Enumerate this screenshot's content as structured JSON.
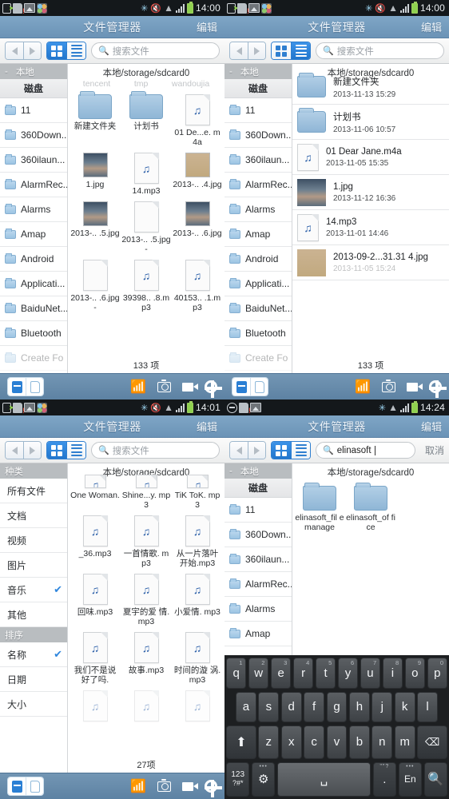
{
  "app": {
    "title": "文件管理器",
    "edit_label": "编辑",
    "search_placeholder": "搜索文件",
    "path": "本地/storage/sdcard0",
    "cancel_label": "取消"
  },
  "icons": {
    "back": "triangle-left-icon",
    "forward": "triangle-right-icon",
    "grid_view": "grid-view-icon",
    "list_view": "list-view-icon",
    "search": "search-icon",
    "wifi": "wifi-icon",
    "camera": "camera-icon",
    "video": "video-icon",
    "settings": "gear-icon"
  },
  "colors": {
    "title_bar": "#6b93b6",
    "app_bar": "#5d82a3",
    "accent_blue": "#2176cd",
    "sidebar_header": "#b9bdc0",
    "check_blue": "#2f86dd",
    "status_bar": "#14181b",
    "battery_green": "#8fd14f"
  },
  "panels": [
    {
      "id": "panel-grid-view",
      "status": {
        "time": "14:00",
        "icons": [
          "usb-icon",
          "sd-card-icon",
          "image-icon",
          "apps-icon",
          "bluetooth-icon",
          "mute-icon",
          "wifi-icon",
          "signal-icon",
          "battery-icon"
        ]
      },
      "view_mode": "grid",
      "search_value": "",
      "sidebar": {
        "header": "本地",
        "header_dash": "-",
        "subheader": "磁盘",
        "items": [
          {
            "label": "11"
          },
          {
            "label": "360Down..."
          },
          {
            "label": "360ilaun..."
          },
          {
            "label": "AlarmRec..."
          },
          {
            "label": "Alarms"
          },
          {
            "label": "Amap"
          },
          {
            "label": "Android"
          },
          {
            "label": "Applicati..."
          },
          {
            "label": "BaiduNet..."
          },
          {
            "label": "Bluetooth"
          },
          {
            "label": "Create Fo"
          }
        ]
      },
      "ghost_row": [
        "tencent",
        "tmp",
        "wandoujia"
      ],
      "items": [
        {
          "name": "新建文件夹",
          "type": "folder"
        },
        {
          "name": "计划书",
          "type": "folder"
        },
        {
          "name": "01 De...e.\nm4a",
          "type": "audio"
        },
        {
          "name": "1.jpg",
          "type": "image-car"
        },
        {
          "name": "14.mp3",
          "type": "audio"
        },
        {
          "name": "2013-..\n.4.jpg",
          "type": "image-tan"
        },
        {
          "name": "2013-..\n.5.jpg",
          "type": "image-car"
        },
        {
          "name": "2013-..\n.5.jpg-",
          "type": "blank"
        },
        {
          "name": "2013-..\n.6.jpg",
          "type": "image-car"
        },
        {
          "name": "2013-..\n.6.jpg-",
          "type": "blank"
        },
        {
          "name": "39398..\n.8.mp3",
          "type": "audio"
        },
        {
          "name": "40153..\n.1.mp3",
          "type": "audio"
        }
      ],
      "count": "133 项"
    },
    {
      "id": "panel-list-view",
      "status": {
        "time": "14:00",
        "icons": [
          "usb-icon",
          "sd-card-icon",
          "image-icon",
          "apps-icon",
          "bluetooth-icon",
          "mute-icon",
          "wifi-icon",
          "signal-icon",
          "battery-icon"
        ]
      },
      "view_mode": "list",
      "search_value": "",
      "sidebar": {
        "header": "本地",
        "header_dash": "-",
        "subheader": "磁盘",
        "items": [
          {
            "label": "11"
          },
          {
            "label": "360Down..."
          },
          {
            "label": "360ilaun..."
          },
          {
            "label": "AlarmRec..."
          },
          {
            "label": "Alarms"
          },
          {
            "label": "Amap"
          },
          {
            "label": "Android"
          },
          {
            "label": "Applicati..."
          },
          {
            "label": "BaiduNet..."
          },
          {
            "label": "Bluetooth"
          },
          {
            "label": "Create Fo"
          }
        ]
      },
      "rows": [
        {
          "name": "新建文件夹",
          "date": "2013-11-13 15:29",
          "type": "folder"
        },
        {
          "name": "计划书",
          "date": "2013-11-06 10:57",
          "type": "folder"
        },
        {
          "name": "01 Dear Jane.m4a",
          "date": "2013-11-05 15:35",
          "type": "audio"
        },
        {
          "name": "1.jpg",
          "date": "2013-11-12 16:36",
          "type": "image-car"
        },
        {
          "name": "14.mp3",
          "date": "2013-11-01 14:46",
          "type": "audio"
        },
        {
          "name": "2013-09-2...31.31 4.jpg",
          "date": "2013-11-05 15:24",
          "type": "image-tan"
        }
      ],
      "count": "133 项"
    },
    {
      "id": "panel-music-filter",
      "status": {
        "time": "14:01",
        "icons": [
          "usb-icon",
          "sd-card-icon",
          "image-icon",
          "apps-icon",
          "bluetooth-icon",
          "mute-icon",
          "wifi-icon",
          "signal-icon",
          "battery-icon"
        ]
      },
      "view_mode": "grid",
      "search_value": "",
      "sidebar": {
        "header": "种类",
        "items": [
          {
            "label": "所有文件",
            "checked": false
          },
          {
            "label": "文档",
            "checked": false
          },
          {
            "label": "视频",
            "checked": false
          },
          {
            "label": "图片",
            "checked": false
          },
          {
            "label": "音乐",
            "checked": true
          },
          {
            "label": "其他",
            "checked": false
          }
        ],
        "header2": "排序",
        "items2": [
          {
            "label": "名称",
            "checked": true
          },
          {
            "label": "日期",
            "checked": false
          },
          {
            "label": "大小",
            "checked": false
          }
        ]
      },
      "items": [
        {
          "name": "One\nWoman.",
          "type": "audio-cut"
        },
        {
          "name": "Shine...y.\nmp3",
          "type": "audio-cut"
        },
        {
          "name": "TiK ToK.\nmp3",
          "type": "audio-cut"
        },
        {
          "name": "_36.mp3",
          "type": "audio"
        },
        {
          "name": "一首情歌.\nmp3",
          "type": "audio"
        },
        {
          "name": "从一片落叶\n开始.mp3",
          "type": "audio"
        },
        {
          "name": "回味.mp3",
          "type": "audio"
        },
        {
          "name": "夏宇的爱\n情.mp3",
          "type": "audio"
        },
        {
          "name": "小爱情.\nmp3",
          "type": "audio"
        },
        {
          "name": "我们不是说\n好了吗.",
          "type": "audio"
        },
        {
          "name": "故事.mp3",
          "type": "audio"
        },
        {
          "name": "时间的漩\n涡.mp3",
          "type": "audio"
        },
        {
          "name": "",
          "type": "audio-faint"
        },
        {
          "name": "",
          "type": "audio-faint"
        },
        {
          "name": "",
          "type": "audio-faint"
        }
      ],
      "count": "27项"
    },
    {
      "id": "panel-search-keyboard",
      "status": {
        "time": "14:24",
        "icons": [
          "minus-circle-icon",
          "sd-card-icon",
          "image-icon",
          "bluetooth-icon",
          "wifi-sync-icon",
          "signal-icon",
          "battery-icon"
        ]
      },
      "view_mode": "grid",
      "search_value": "elinasoft",
      "sidebar": {
        "header": "本地",
        "header_dash": "-",
        "subheader": "磁盘",
        "items": [
          {
            "label": "11"
          },
          {
            "label": "360Down..."
          },
          {
            "label": "360ilaun..."
          },
          {
            "label": "AlarmRec..."
          },
          {
            "label": "Alarms"
          },
          {
            "label": "Amap"
          }
        ]
      },
      "items": [
        {
          "name": "elinasoft_fil\nemanage",
          "type": "folder"
        },
        {
          "name": "elinasoft_of\nfice",
          "type": "folder"
        }
      ],
      "keyboard": {
        "row1": [
          {
            "key": "q",
            "sup": "1"
          },
          {
            "key": "w",
            "sup": "2"
          },
          {
            "key": "e",
            "sup": "3"
          },
          {
            "key": "r",
            "sup": "4"
          },
          {
            "key": "t",
            "sup": "5"
          },
          {
            "key": "y",
            "sup": "6"
          },
          {
            "key": "u",
            "sup": "7"
          },
          {
            "key": "i",
            "sup": "8"
          },
          {
            "key": "o",
            "sup": "9"
          },
          {
            "key": "p",
            "sup": "0"
          }
        ],
        "row2": [
          {
            "key": "a"
          },
          {
            "key": "s"
          },
          {
            "key": "d"
          },
          {
            "key": "f"
          },
          {
            "key": "g"
          },
          {
            "key": "h"
          },
          {
            "key": "j"
          },
          {
            "key": "k"
          },
          {
            "key": "l"
          }
        ],
        "row3_shift": "⬆",
        "row3": [
          {
            "key": "z"
          },
          {
            "key": "x"
          },
          {
            "key": "c"
          },
          {
            "key": "v"
          },
          {
            "key": "b"
          },
          {
            "key": "n"
          },
          {
            "key": "m"
          }
        ],
        "row3_delete": "⌫",
        "row4_symbols_top": "123",
        "row4_symbols_bottom": "?#*",
        "row4_settings": "gear-icon",
        "row4_space": "␣",
        "row4_period_top": "\"\"?",
        "row4_period": ".",
        "row4_lang": "En",
        "row4_search": "search-icon"
      }
    }
  ]
}
